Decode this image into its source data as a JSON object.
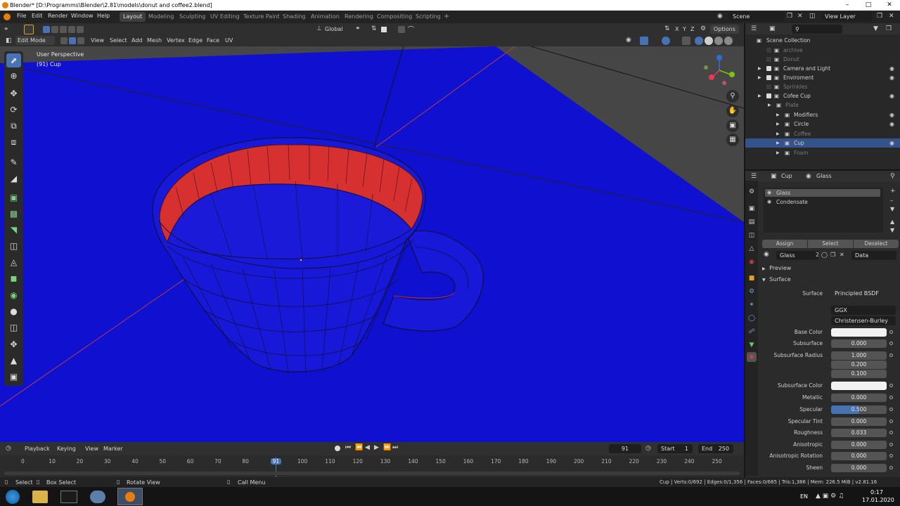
{
  "window": {
    "title": "Blender* [D:\\Programms\\Blender\\2.81\\models\\donut and coffee2.blend]"
  },
  "menu": [
    "File",
    "Edit",
    "Render",
    "Window",
    "Help"
  ],
  "workspaces": [
    "Layout",
    "Modeling",
    "Sculpting",
    "UV Editing",
    "Texture Paint",
    "Shading",
    "Animation",
    "Rendering",
    "Compositing",
    "Scripting"
  ],
  "scene": {
    "name": "Scene",
    "view_layer": "View Layer"
  },
  "viewport": {
    "mode": "Edit Mode",
    "header_menus": [
      "View",
      "Select",
      "Add",
      "Mesh",
      "Vertex",
      "Edge",
      "Face",
      "UV"
    ],
    "orientation": "Global",
    "options_label": "Options",
    "axes": [
      "X",
      "Y",
      "Z"
    ],
    "overlay_title": "User Perspective",
    "overlay_object": "(91) Cup",
    "colors": {
      "floor": "#1010d0",
      "cup": "#1818d8",
      "rim": "#d63030",
      "background": "#464646",
      "active_tool": "#4772b3"
    }
  },
  "outliner": {
    "root": "Scene Collection",
    "items": [
      {
        "label": "archive",
        "dim": true
      },
      {
        "label": "Donut",
        "dim": true
      },
      {
        "label": "Camera and Light",
        "dim": false
      },
      {
        "label": "Enviroment",
        "dim": false
      },
      {
        "label": "Sprinkles",
        "dim": true
      },
      {
        "label": "Cofee Cup",
        "dim": false
      },
      {
        "label": "Plate",
        "dim": true
      },
      {
        "label": "Modifiers",
        "dim": false
      },
      {
        "label": "Circle",
        "dim": false
      },
      {
        "label": "Coffee",
        "dim": true
      },
      {
        "label": "Cup",
        "dim": false,
        "selected": true
      },
      {
        "label": "Foam",
        "dim": true
      }
    ]
  },
  "properties": {
    "object": "Cup",
    "material": "Glass",
    "slots": [
      "Glass",
      "Condensate"
    ],
    "slot_buttons": [
      "Assign",
      "Select",
      "Deselect"
    ],
    "material_field": "Glass",
    "material_users": "2",
    "link": "Data",
    "panels": [
      "Preview",
      "Surface"
    ],
    "surface": {
      "surface_label": "Surface",
      "surface_value": "Principled BSDF",
      "distribution": "GGX",
      "subsurface_method": "Christensen-Burley",
      "fields": [
        {
          "label": "Base Color",
          "value": "",
          "kind": "color"
        },
        {
          "label": "Subsurface",
          "value": "0.000"
        },
        {
          "label": "Subsurface Radius",
          "value": "1.000"
        },
        {
          "label": "",
          "value": "0.200"
        },
        {
          "label": "",
          "value": "0.100"
        },
        {
          "label": "Subsurface Color",
          "value": "",
          "kind": "color"
        },
        {
          "label": "Metallic",
          "value": "0.000"
        },
        {
          "label": "Specular",
          "value": "0.500",
          "kind": "highlight"
        },
        {
          "label": "Specular Tint",
          "value": "0.000"
        },
        {
          "label": "Roughness",
          "value": "0.033"
        },
        {
          "label": "Anisotropic",
          "value": "0.000"
        },
        {
          "label": "Anisotropic Rotation",
          "value": "0.000"
        },
        {
          "label": "Sheen",
          "value": "0.000"
        }
      ]
    }
  },
  "timeline": {
    "menus": [
      "Playback",
      "Keying",
      "View",
      "Marker"
    ],
    "current_frame": "91",
    "start_label": "Start",
    "start": "1",
    "end_label": "End",
    "end": "250",
    "ticks": [
      "0",
      "10",
      "20",
      "30",
      "40",
      "50",
      "60",
      "70",
      "80",
      "91",
      "100",
      "110",
      "120",
      "130",
      "140",
      "150",
      "160",
      "170",
      "180",
      "190",
      "200",
      "210",
      "220",
      "230",
      "240",
      "250"
    ]
  },
  "statusbar": {
    "left": [
      "Select",
      "Box Select",
      "Rotate View",
      "Call Menu"
    ],
    "right": "Cup | Verts:0/692 | Edges:0/1,356 | Faces:0/665 | Tris:1,386 | Mem: 226.5 MiB | v2.81.16"
  },
  "taskbar": {
    "lang": "EN",
    "time": "0:17",
    "date": "17.01.2020"
  }
}
